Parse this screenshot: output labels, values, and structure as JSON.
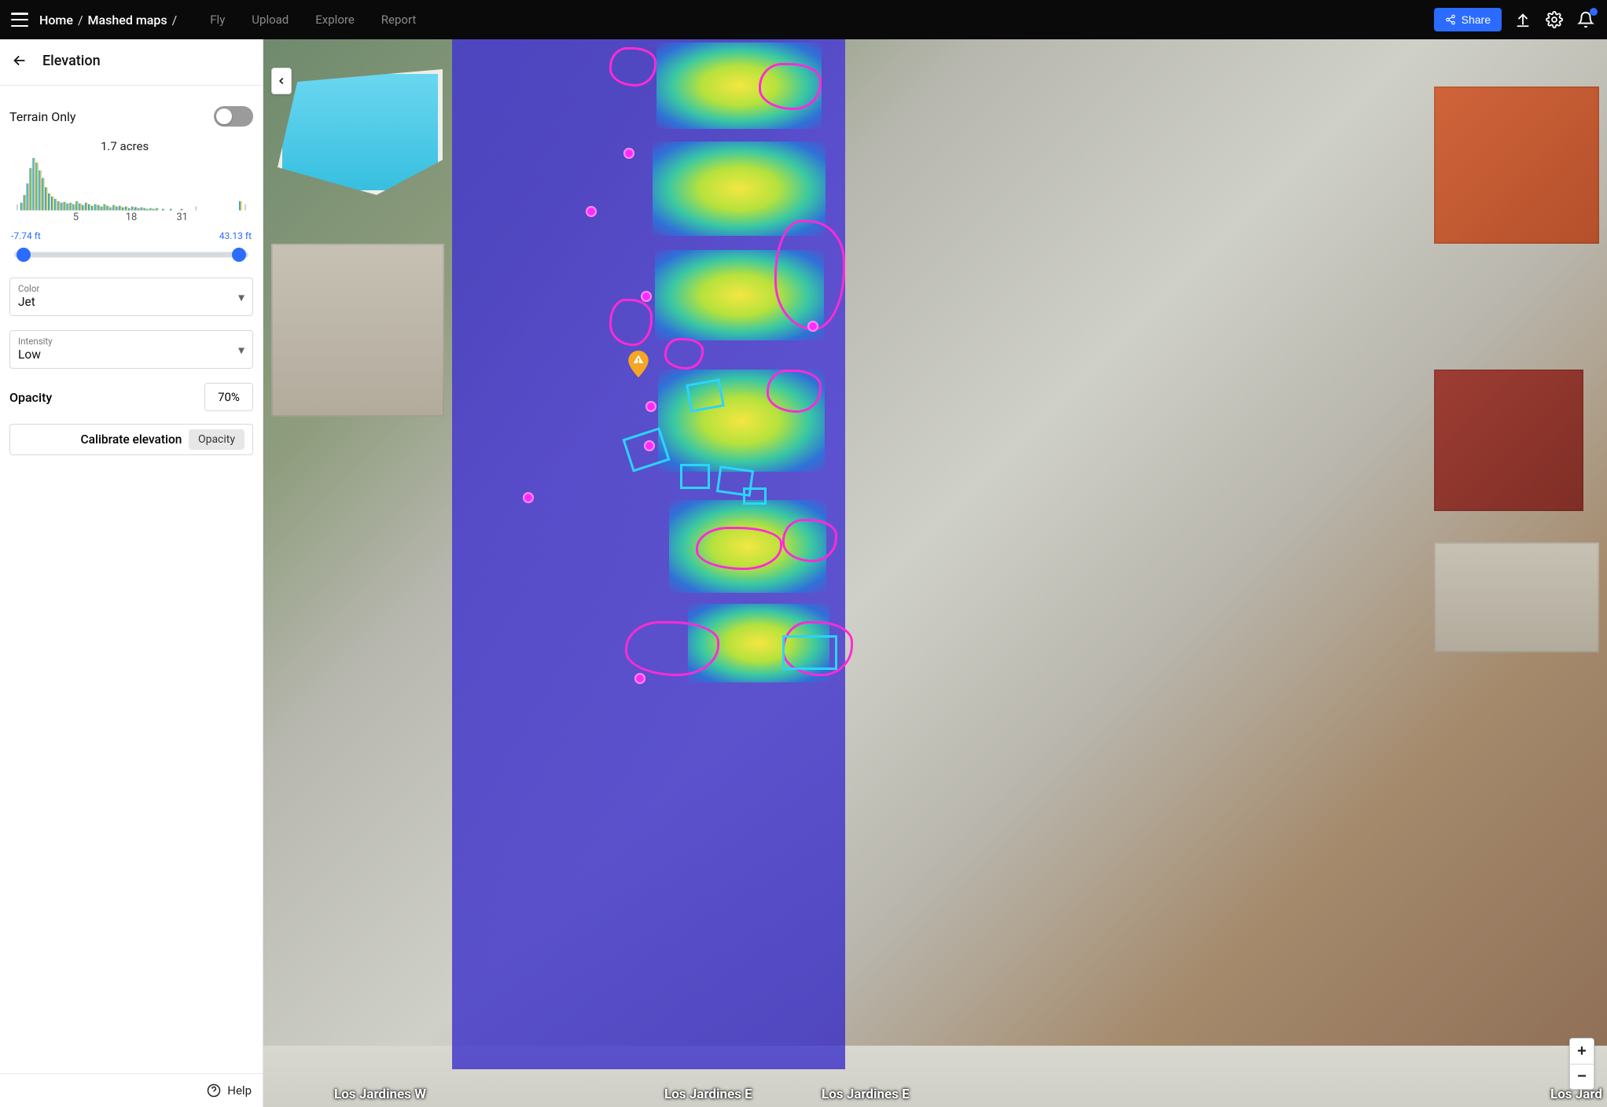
{
  "topbar": {
    "breadcrumbs": [
      "Home",
      "Mashed maps"
    ],
    "nav": {
      "fly": "Fly",
      "upload": "Upload",
      "explore": "Explore",
      "report": "Report"
    },
    "share_label": "Share"
  },
  "panel": {
    "title": "Elevation",
    "terrain_only_label": "Terrain Only",
    "area_label": "1.7 acres",
    "histogram_ticks": [
      "5",
      "18",
      "31"
    ],
    "range_min": "-7.74 ft",
    "range_max": "43.13 ft",
    "color_label": "Color",
    "color_value": "Jet",
    "intensity_label": "Intensity",
    "intensity_value": "Low",
    "opacity_label": "Opacity",
    "opacity_value": "70%",
    "calibrate_label": "Calibrate elevation",
    "tooltip_text": "Opacity"
  },
  "footer": {
    "help": "Help"
  },
  "map": {
    "street_labels": [
      "Los Jardines W",
      "Los Jardines E",
      "Los Jardines E",
      "Los Jard"
    ]
  }
}
